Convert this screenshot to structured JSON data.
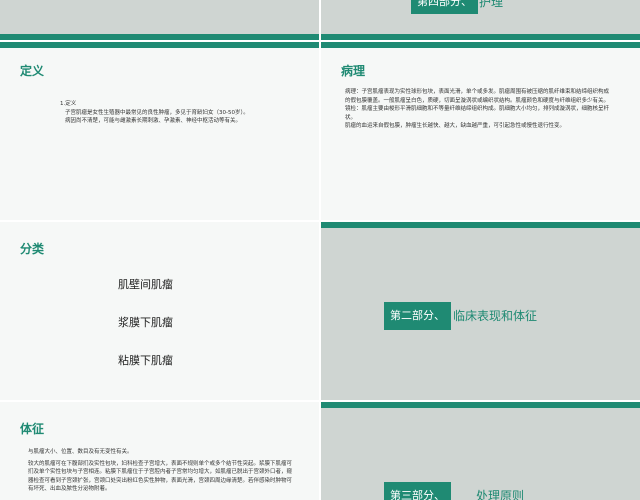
{
  "slides": {
    "top_left": {},
    "top_right": {
      "badge": "第四部分、",
      "title": "护理"
    },
    "definition": {
      "title": "定义",
      "lines": [
        "1.定义",
        "子宫肌瘤是女性生殖器中最常见的良性肿瘤，多见于育龄妇女（30-50岁）。",
        "病因尚不清楚，可能与雌激素长期刺激、孕激素、神经中枢活动等有关。"
      ]
    },
    "pathology": {
      "title": "病理",
      "lines": [
        "病理：子宫肌瘤表现为实性球形包块，表面光滑，单个或多发。肌瘤周围有被压缩的肌纤维束和结缔组织构成的假包膜覆盖。一般肌瘤呈白色，质硬，切面呈漩涡状或编织状结构。肌瘤颜色和硬度与纤维组织多少有关。",
        "镜检：肌瘤主要由梭形平滑肌细胞和不等量纤维结缔组织构成。肌细胞大小均匀，排列成漩涡状，细胞核呈杆状。",
        "肌瘤的血运来自假包膜，肿瘤生长越快、越大，缺血越严重，可引起急性或慢性退行性变。"
      ]
    },
    "classification": {
      "title": "分类",
      "items": [
        "肌壁间肌瘤",
        "浆膜下肌瘤",
        "粘膜下肌瘤"
      ]
    },
    "section2": {
      "badge": "第二部分、",
      "title": "临床表现和体征"
    },
    "signs": {
      "title": "体征",
      "lines": [
        "与肌瘤大小、位置、数目及有无变性有关。",
        "较大的肌瘤可在下腹部扪及实性包块，妇科检查子宫增大，表面不规则单个或多个结节性突起。浆膜下肌瘤可扪及单个实性包块与子宫相连。粘膜下肌瘤位于子宫腔内者子宫常均匀增大，如肌瘤已脱出于宫颈外口者，窥器检查可看到子宫颈扩张，宫颈口处突出粉红色实性肿物，表面光滑，宫颈四周边缘清楚。若伴感染时肿物可有坏死、出血及脓性分泌物附着。"
      ]
    },
    "section3": {
      "badge": "第三部分、",
      "title": "处理原则"
    }
  },
  "colors": {
    "accent": "#1f8a73",
    "slide_bg": "#f6f8f7",
    "gray_bg": "#cfd5d2"
  }
}
